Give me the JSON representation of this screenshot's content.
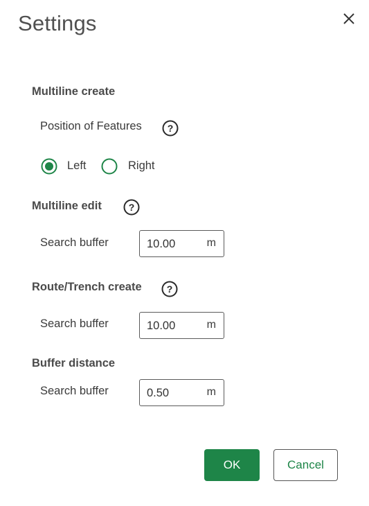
{
  "dialog": {
    "title": "Settings"
  },
  "icons": {
    "close": "close-icon",
    "help": "question-circle-icon"
  },
  "colors": {
    "accent": "#1e8548",
    "border": "#5a5a5a",
    "text": "#323232"
  },
  "multiline_create": {
    "heading": "Multiline create",
    "position_label": "Position of Features",
    "options": [
      {
        "label": "Left",
        "selected": true
      },
      {
        "label": "Right",
        "selected": false
      }
    ]
  },
  "multiline_edit": {
    "heading": "Multiline edit",
    "field_label": "Search buffer",
    "value": "10.00",
    "unit": "m"
  },
  "route_trench_create": {
    "heading": "Route/Trench create",
    "field_label": "Search buffer",
    "value": "10.00",
    "unit": "m"
  },
  "buffer_distance": {
    "heading": "Buffer distance",
    "field_label": "Search buffer",
    "value": "0.50",
    "unit": "m"
  },
  "footer": {
    "ok_label": "OK",
    "cancel_label": "Cancel"
  }
}
